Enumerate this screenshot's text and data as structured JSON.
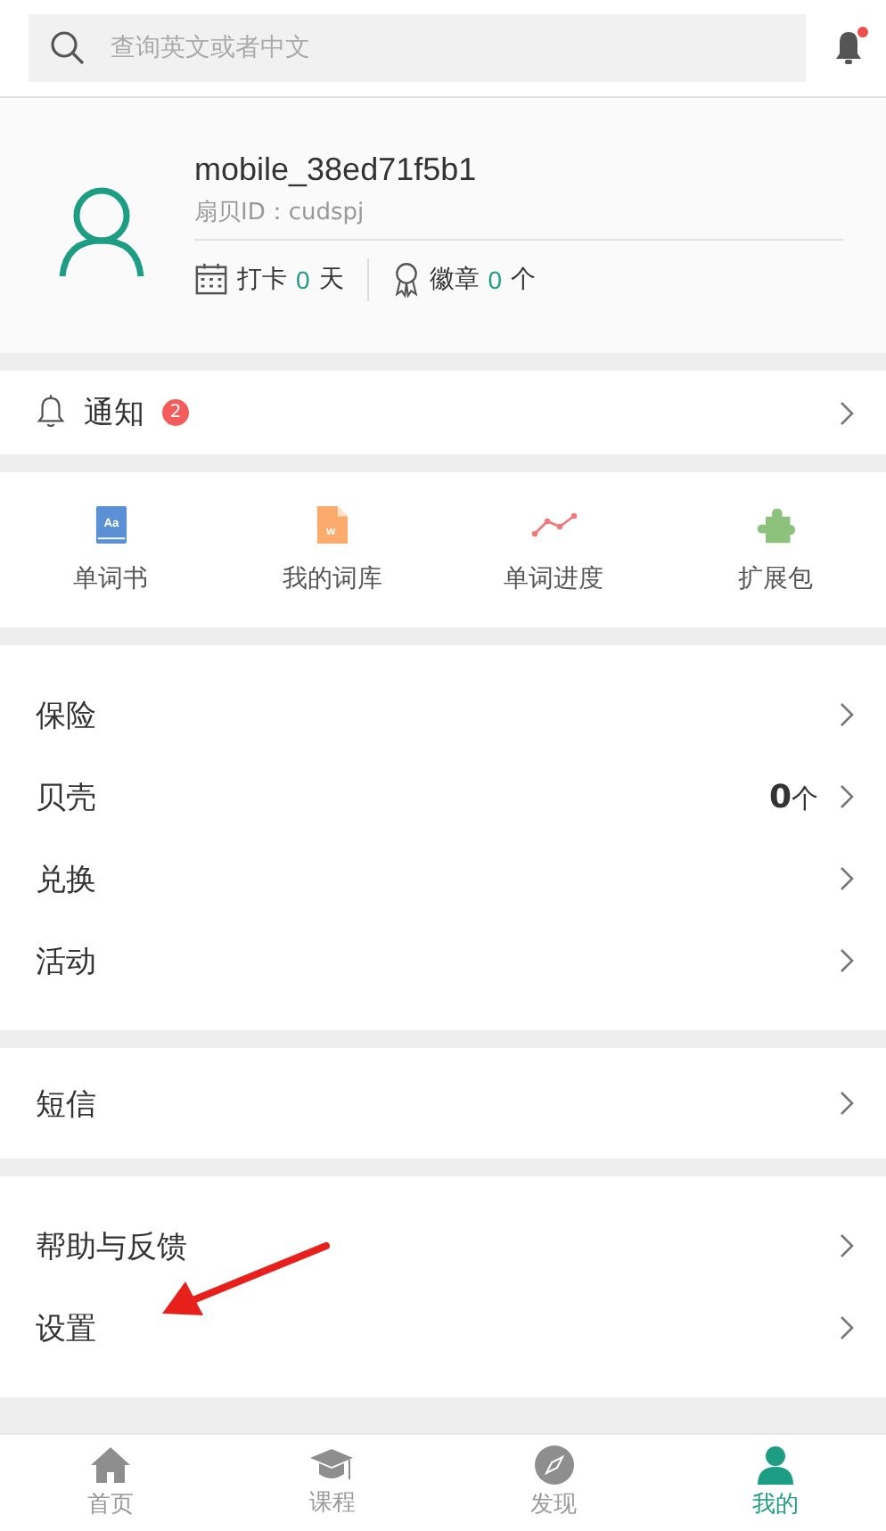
{
  "search": {
    "placeholder": "查询英文或者中文"
  },
  "header": {
    "has_unread": true
  },
  "profile": {
    "username": "mobile_38ed71f5b1",
    "id_line": "扇贝ID：cudspj",
    "checkin": {
      "label": "打卡",
      "count": "0",
      "unit": "天"
    },
    "badges": {
      "label": "徽章",
      "count": "0",
      "unit": "个"
    }
  },
  "notification": {
    "label": "通知",
    "badge": "2"
  },
  "shortcuts": [
    {
      "kind": "book",
      "glyph": "Aa",
      "label": "单词书"
    },
    {
      "kind": "file",
      "glyph": "w",
      "label": "我的词库"
    },
    {
      "kind": "chart",
      "label": "单词进度"
    },
    {
      "kind": "puzzle",
      "label": "扩展包"
    }
  ],
  "menu_groups": [
    [
      {
        "label": "保险"
      },
      {
        "label": "贝壳",
        "value": "0",
        "unit": "个"
      },
      {
        "label": "兑换"
      },
      {
        "label": "活动"
      }
    ],
    [
      {
        "label": "短信"
      }
    ],
    [
      {
        "label": "帮助与反馈"
      },
      {
        "label": "设置"
      }
    ]
  ],
  "annotation": {
    "kind": "arrow"
  },
  "tabs": [
    {
      "kind": "home",
      "label": "首页",
      "selected": false
    },
    {
      "kind": "course",
      "label": "课程",
      "selected": false
    },
    {
      "kind": "discover",
      "label": "发现",
      "selected": false
    },
    {
      "kind": "me",
      "label": "我的",
      "selected": true
    }
  ]
}
